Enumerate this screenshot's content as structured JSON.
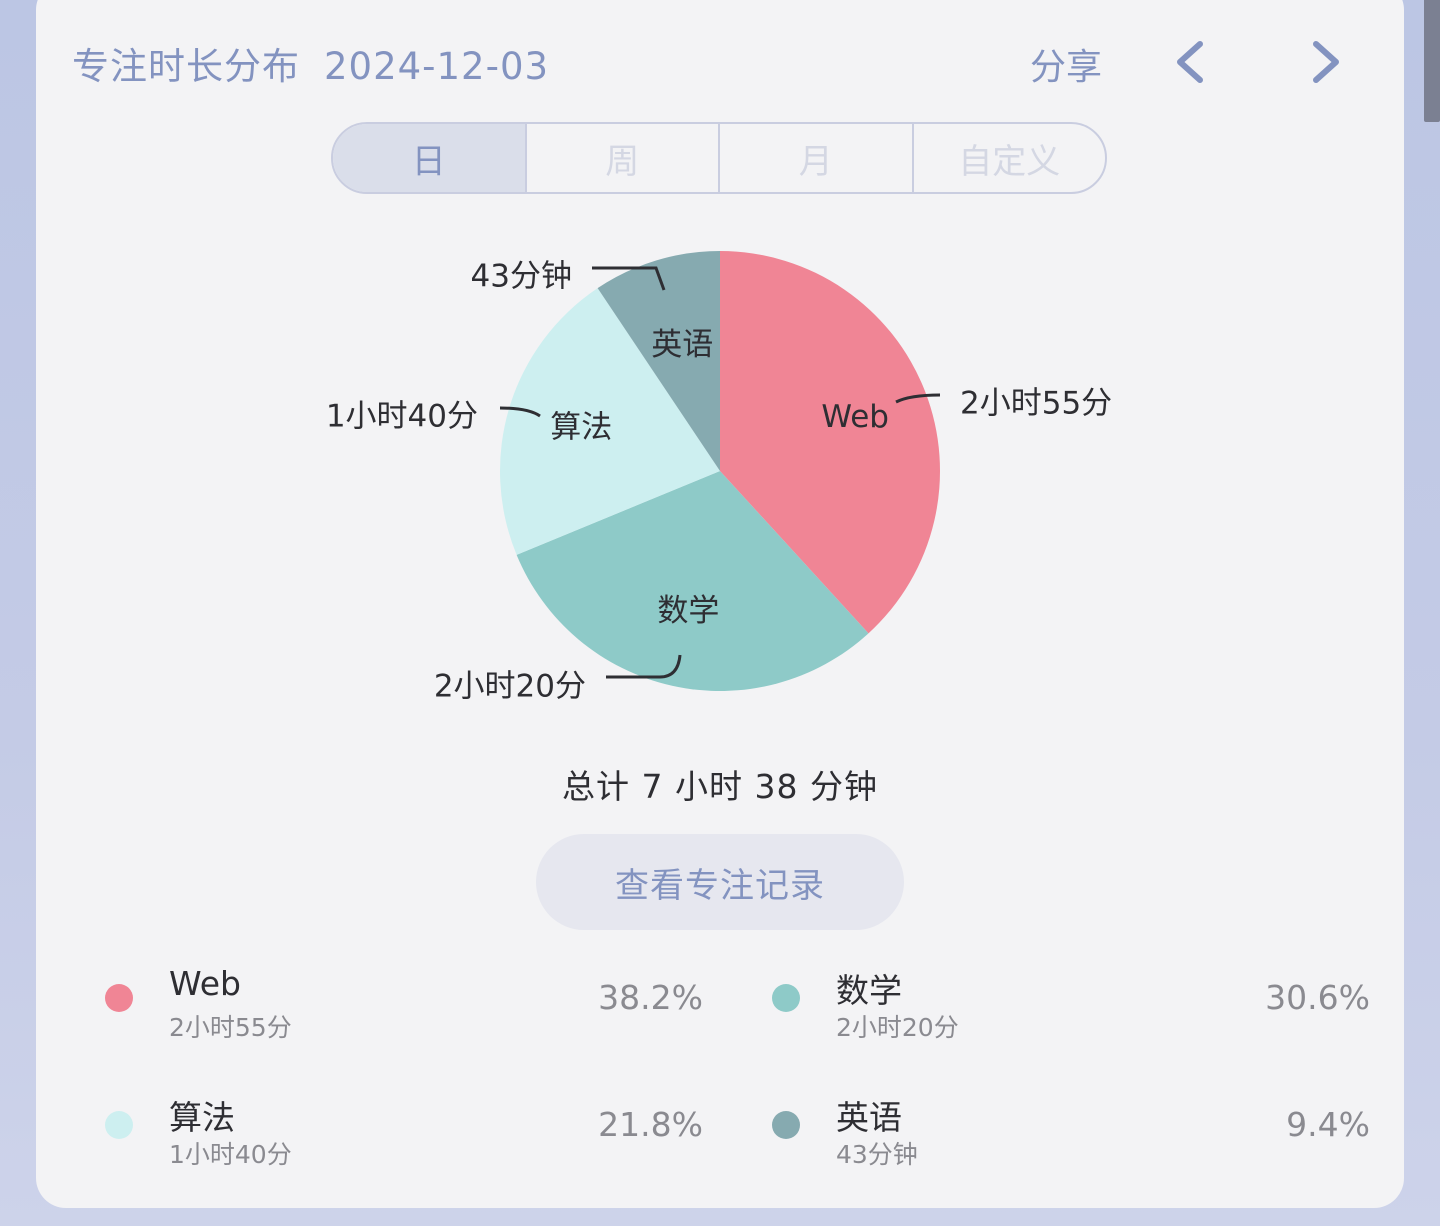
{
  "header": {
    "title": "专注时长分布",
    "date": "2024-12-03",
    "share_label": "分享"
  },
  "tabs": [
    {
      "label": "日",
      "active": true
    },
    {
      "label": "周",
      "active": false
    },
    {
      "label": "月",
      "active": false
    },
    {
      "label": "自定义",
      "active": false
    }
  ],
  "chart_data": {
    "type": "pie",
    "slices": [
      {
        "name": "Web",
        "duration": "2小时55分",
        "minutes": 175,
        "percent": "38.2%",
        "color": "#f08595"
      },
      {
        "name": "数学",
        "duration": "2小时20分",
        "minutes": 140,
        "percent": "30.6%",
        "color": "#8ecac8"
      },
      {
        "name": "算法",
        "duration": "1小时40分",
        "minutes": 100,
        "percent": "21.8%",
        "color": "#cdeff0"
      },
      {
        "name": "英语",
        "duration": "43分钟",
        "minutes": 43,
        "percent": "9.4%",
        "color": "#86aab0"
      }
    ]
  },
  "summary": {
    "total": "总计 7 小时 38 分钟"
  },
  "records_button_label": "查看专注记录",
  "colors": {
    "accent": "#8393c0",
    "card_background": "#f3f3f5",
    "page_background": "#c4cbe6"
  },
  "icons": {
    "prev": "chevron-left-icon",
    "next": "chevron-right-icon"
  }
}
